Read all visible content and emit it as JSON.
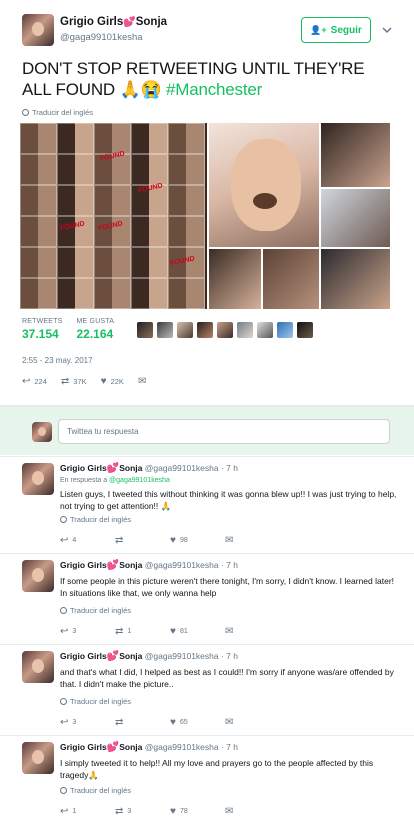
{
  "main_tweet": {
    "display_name": "Grigio Girls",
    "display_name_suffix": "Sonja",
    "heart": "💕",
    "handle": "@gaga99101kesha",
    "follow_label": "Seguir",
    "text_main": "DON'T STOP RETWEETING UNTIL THEY'RE ALL FOUND",
    "text_emoji": "🙏😭",
    "hashtag": "#Manchester",
    "translate_label": "Traducir del inglés",
    "found_tags": [
      "FOUND",
      "FOUND",
      "FOUND",
      "FOUND",
      "FOUND"
    ],
    "retweets_label": "RETWEETS",
    "retweets_value": "37.154",
    "likes_label": "ME GUSTA",
    "likes_value": "22.164",
    "timestamp": "2:55 - 23 may. 2017",
    "actions": {
      "reply_count": "224",
      "retweet_count": "37K",
      "like_count": "22K"
    }
  },
  "reply_box": {
    "placeholder": "Twittea tu respuesta"
  },
  "replies": [
    {
      "name": "Grigio Girls",
      "name_suffix": "Sonja",
      "meta": "@gaga99101kesha · 7 h",
      "reply_to_prefix": "En respuesta a",
      "reply_to_handle": "@gaga99101kesha",
      "text": "Listen guys, I tweeted this without thinking it was gonna blew up!! I was just trying to help, not trying to get attention!! 🙏",
      "translate": "Traducir del inglés",
      "reply_count": "4",
      "retweet_count": "",
      "like_count": "98"
    },
    {
      "name": "Grigio Girls",
      "name_suffix": "Sonja",
      "meta": "@gaga99101kesha · 7 h",
      "text": "If some people in this picture weren't there tonight, I'm sorry, I didn't know. I learned later! In situations like that, we only wanna help",
      "translate": "Traducir del inglés",
      "reply_count": "3",
      "retweet_count": "1",
      "like_count": "81"
    },
    {
      "name": "Grigio Girls",
      "name_suffix": "Sonja",
      "meta": "@gaga99101kesha · 7 h",
      "text": "and that's what I did, I helped as best as I could!! I'm sorry if anyone was/are offended by that. I didn't make the picture..",
      "translate": "Traducir del inglés",
      "reply_count": "3",
      "retweet_count": "",
      "like_count": "65"
    },
    {
      "name": "Grigio Girls",
      "name_suffix": "Sonja",
      "meta": "@gaga99101kesha · 7 h",
      "text": "I simply tweeted it to help!! All my love and prayers go to the people affected by this tragedy🙏",
      "translate": "Traducir del inglés",
      "reply_count": "1",
      "retweet_count": "3",
      "like_count": "78"
    }
  ],
  "icons": {
    "follow": "add-user-icon",
    "chevron": "chevron-down-icon",
    "reply": "reply-icon",
    "retweet": "retweet-icon",
    "like": "heart-icon",
    "message": "direct-message-icon",
    "translate": "globe-icon"
  },
  "colors": {
    "accent_green": "#17bf63",
    "text": "#14171a",
    "muted": "#657786",
    "reply_bar_bg": "#e8f5ec"
  }
}
